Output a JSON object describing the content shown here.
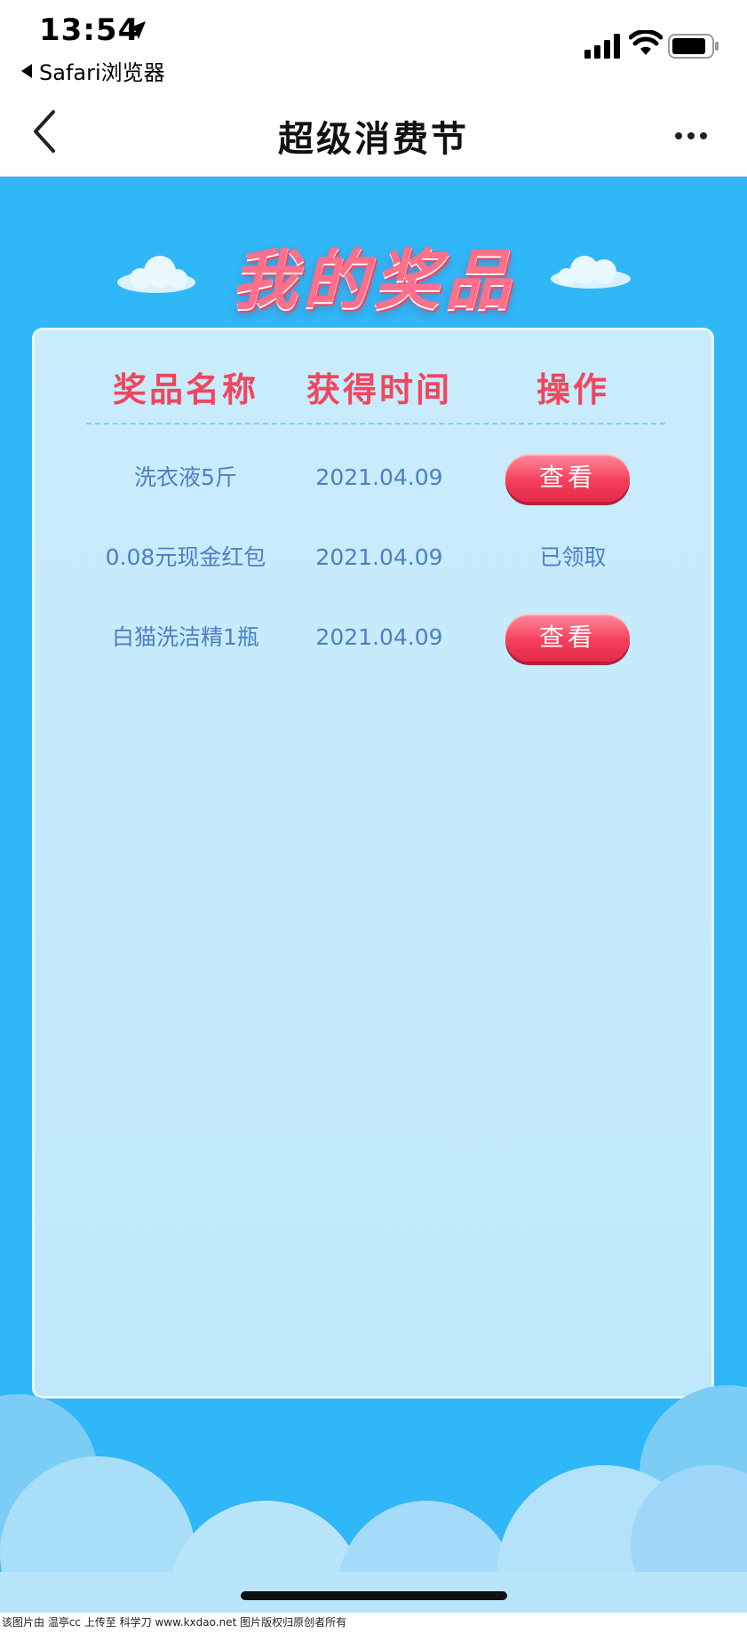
{
  "status_bar": {
    "time": "13:54",
    "back_app": "Safari浏览器"
  },
  "nav": {
    "title": "超级消费节"
  },
  "heading": "我的奖品",
  "table": {
    "headers": [
      "奖品名称",
      "获得时间",
      "操作"
    ],
    "rows": [
      {
        "name": "洗衣液5斤",
        "time": "2021.04.09",
        "action": "查看",
        "action_type": "button"
      },
      {
        "name": "0.08元现金红包",
        "time": "2021.04.09",
        "action": "已领取",
        "action_type": "text"
      },
      {
        "name": "白猫洗洁精1瓶",
        "time": "2021.04.09",
        "action": "查看",
        "action_type": "button"
      }
    ]
  },
  "watermark": "该图片由 温亭cc 上传至 科学刀 www.kxdao.net 图片版权归原创者所有",
  "colors": {
    "background": "#2fb7f7",
    "card": "#c9ecfb",
    "accent": "#f0465f",
    "cell_text": "#4d7fc4"
  },
  "icons": [
    "location-arrow-icon",
    "signal-icon",
    "wifi-icon",
    "battery-icon",
    "back-chevron-icon",
    "more-icon",
    "cloud-icon"
  ]
}
